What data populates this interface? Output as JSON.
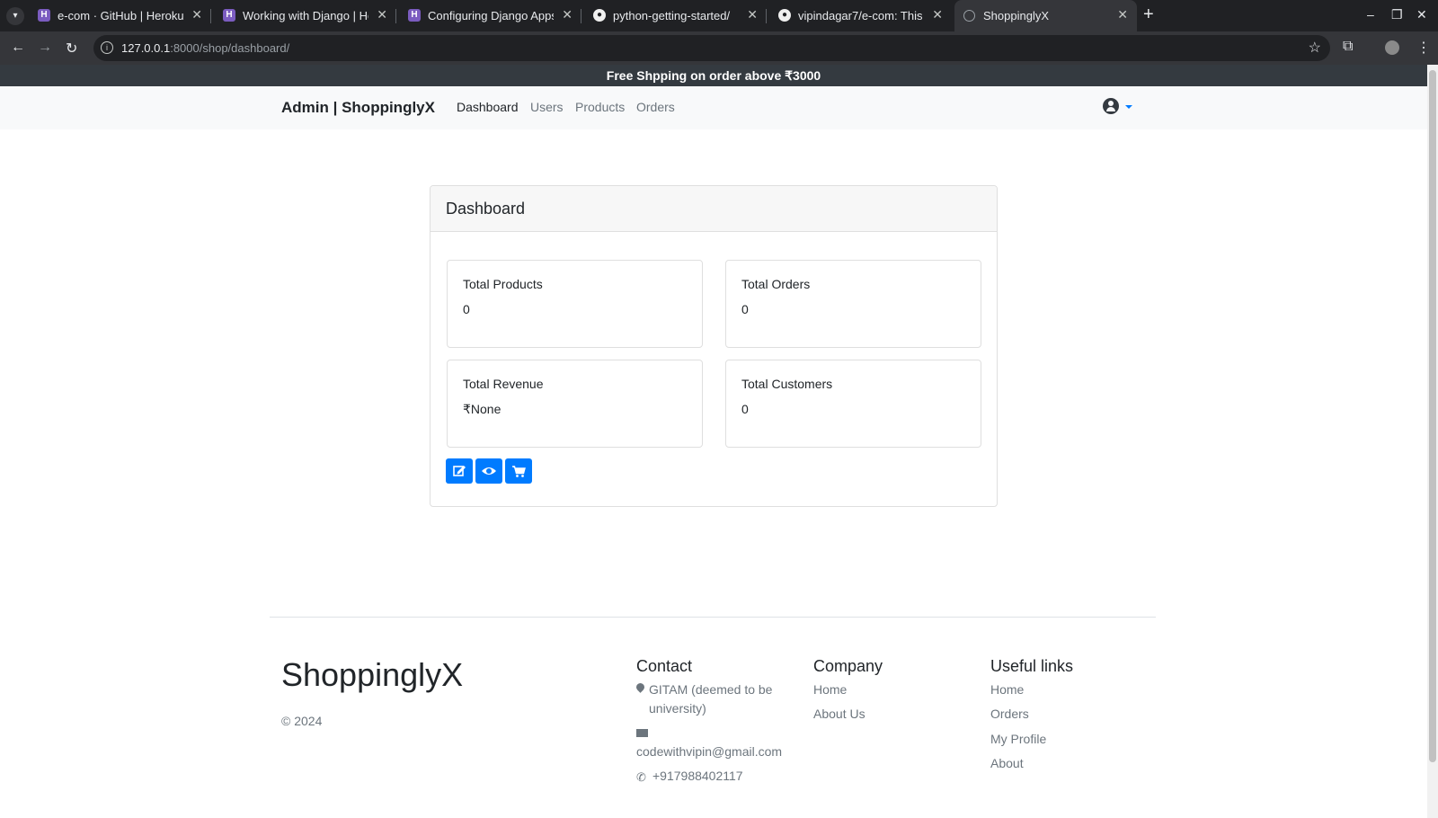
{
  "browser": {
    "tabs": [
      {
        "title": "e-com · GitHub | Heroku",
        "icon": "heroku-icon"
      },
      {
        "title": "Working with Django | Heroku",
        "icon": "heroku-icon"
      },
      {
        "title": "Configuring Django Apps",
        "icon": "heroku-icon"
      },
      {
        "title": "python-getting-started/",
        "icon": "github-icon"
      },
      {
        "title": "vipindagar7/e-com: This",
        "icon": "github-icon"
      },
      {
        "title": "ShoppinglyX",
        "icon": "globe-icon"
      }
    ],
    "url_host": "127.0.0.1",
    "url_rest": ":8000/shop/dashboard/"
  },
  "promo": "Free Shpping on order above ₹3000",
  "navbar": {
    "brand": "Admin | ShoppinglyX",
    "links": [
      "Dashboard",
      "Users",
      "Products",
      "Orders"
    ],
    "active": "Dashboard"
  },
  "dashboard": {
    "title": "Dashboard",
    "stats": [
      {
        "label": "Total Products",
        "value": "0"
      },
      {
        "label": "Total Orders",
        "value": "0"
      },
      {
        "label": "Total Revenue",
        "value": "₹None"
      },
      {
        "label": "Total Customers",
        "value": "0"
      }
    ],
    "actions": [
      "edit-icon",
      "eye-icon",
      "cart-icon"
    ],
    "accent": "#007bff"
  },
  "footer": {
    "brand": "ShoppinglyX",
    "copyright": "© 2024",
    "contact": {
      "heading": "Contact",
      "address": "GITAM (deemed to be university)",
      "email": "codewithvipin@gmail.com",
      "phone": "+917988402117"
    },
    "company": {
      "heading": "Company",
      "links": [
        "Home",
        "About Us"
      ]
    },
    "useful": {
      "heading": "Useful links",
      "links": [
        "Home",
        "Orders",
        "My Profile",
        "About"
      ]
    }
  }
}
